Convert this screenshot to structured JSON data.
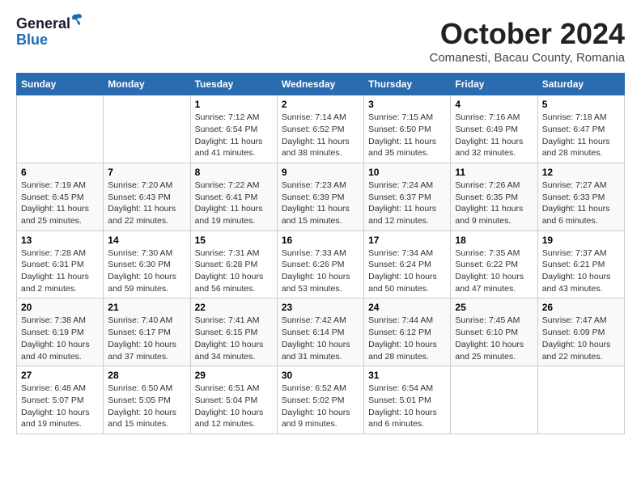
{
  "logo": {
    "general": "General",
    "blue": "Blue"
  },
  "title": "October 2024",
  "subtitle": "Comanesti, Bacau County, Romania",
  "weekdays": [
    "Sunday",
    "Monday",
    "Tuesday",
    "Wednesday",
    "Thursday",
    "Friday",
    "Saturday"
  ],
  "weeks": [
    [
      {
        "day": null,
        "info": ""
      },
      {
        "day": null,
        "info": ""
      },
      {
        "day": "1",
        "info": "Sunrise: 7:12 AM\nSunset: 6:54 PM\nDaylight: 11 hours and 41 minutes."
      },
      {
        "day": "2",
        "info": "Sunrise: 7:14 AM\nSunset: 6:52 PM\nDaylight: 11 hours and 38 minutes."
      },
      {
        "day": "3",
        "info": "Sunrise: 7:15 AM\nSunset: 6:50 PM\nDaylight: 11 hours and 35 minutes."
      },
      {
        "day": "4",
        "info": "Sunrise: 7:16 AM\nSunset: 6:49 PM\nDaylight: 11 hours and 32 minutes."
      },
      {
        "day": "5",
        "info": "Sunrise: 7:18 AM\nSunset: 6:47 PM\nDaylight: 11 hours and 28 minutes."
      }
    ],
    [
      {
        "day": "6",
        "info": "Sunrise: 7:19 AM\nSunset: 6:45 PM\nDaylight: 11 hours and 25 minutes."
      },
      {
        "day": "7",
        "info": "Sunrise: 7:20 AM\nSunset: 6:43 PM\nDaylight: 11 hours and 22 minutes."
      },
      {
        "day": "8",
        "info": "Sunrise: 7:22 AM\nSunset: 6:41 PM\nDaylight: 11 hours and 19 minutes."
      },
      {
        "day": "9",
        "info": "Sunrise: 7:23 AM\nSunset: 6:39 PM\nDaylight: 11 hours and 15 minutes."
      },
      {
        "day": "10",
        "info": "Sunrise: 7:24 AM\nSunset: 6:37 PM\nDaylight: 11 hours and 12 minutes."
      },
      {
        "day": "11",
        "info": "Sunrise: 7:26 AM\nSunset: 6:35 PM\nDaylight: 11 hours and 9 minutes."
      },
      {
        "day": "12",
        "info": "Sunrise: 7:27 AM\nSunset: 6:33 PM\nDaylight: 11 hours and 6 minutes."
      }
    ],
    [
      {
        "day": "13",
        "info": "Sunrise: 7:28 AM\nSunset: 6:31 PM\nDaylight: 11 hours and 2 minutes."
      },
      {
        "day": "14",
        "info": "Sunrise: 7:30 AM\nSunset: 6:30 PM\nDaylight: 10 hours and 59 minutes."
      },
      {
        "day": "15",
        "info": "Sunrise: 7:31 AM\nSunset: 6:28 PM\nDaylight: 10 hours and 56 minutes."
      },
      {
        "day": "16",
        "info": "Sunrise: 7:33 AM\nSunset: 6:26 PM\nDaylight: 10 hours and 53 minutes."
      },
      {
        "day": "17",
        "info": "Sunrise: 7:34 AM\nSunset: 6:24 PM\nDaylight: 10 hours and 50 minutes."
      },
      {
        "day": "18",
        "info": "Sunrise: 7:35 AM\nSunset: 6:22 PM\nDaylight: 10 hours and 47 minutes."
      },
      {
        "day": "19",
        "info": "Sunrise: 7:37 AM\nSunset: 6:21 PM\nDaylight: 10 hours and 43 minutes."
      }
    ],
    [
      {
        "day": "20",
        "info": "Sunrise: 7:38 AM\nSunset: 6:19 PM\nDaylight: 10 hours and 40 minutes."
      },
      {
        "day": "21",
        "info": "Sunrise: 7:40 AM\nSunset: 6:17 PM\nDaylight: 10 hours and 37 minutes."
      },
      {
        "day": "22",
        "info": "Sunrise: 7:41 AM\nSunset: 6:15 PM\nDaylight: 10 hours and 34 minutes."
      },
      {
        "day": "23",
        "info": "Sunrise: 7:42 AM\nSunset: 6:14 PM\nDaylight: 10 hours and 31 minutes."
      },
      {
        "day": "24",
        "info": "Sunrise: 7:44 AM\nSunset: 6:12 PM\nDaylight: 10 hours and 28 minutes."
      },
      {
        "day": "25",
        "info": "Sunrise: 7:45 AM\nSunset: 6:10 PM\nDaylight: 10 hours and 25 minutes."
      },
      {
        "day": "26",
        "info": "Sunrise: 7:47 AM\nSunset: 6:09 PM\nDaylight: 10 hours and 22 minutes."
      }
    ],
    [
      {
        "day": "27",
        "info": "Sunrise: 6:48 AM\nSunset: 5:07 PM\nDaylight: 10 hours and 19 minutes."
      },
      {
        "day": "28",
        "info": "Sunrise: 6:50 AM\nSunset: 5:05 PM\nDaylight: 10 hours and 15 minutes."
      },
      {
        "day": "29",
        "info": "Sunrise: 6:51 AM\nSunset: 5:04 PM\nDaylight: 10 hours and 12 minutes."
      },
      {
        "day": "30",
        "info": "Sunrise: 6:52 AM\nSunset: 5:02 PM\nDaylight: 10 hours and 9 minutes."
      },
      {
        "day": "31",
        "info": "Sunrise: 6:54 AM\nSunset: 5:01 PM\nDaylight: 10 hours and 6 minutes."
      },
      {
        "day": null,
        "info": ""
      },
      {
        "day": null,
        "info": ""
      }
    ]
  ]
}
